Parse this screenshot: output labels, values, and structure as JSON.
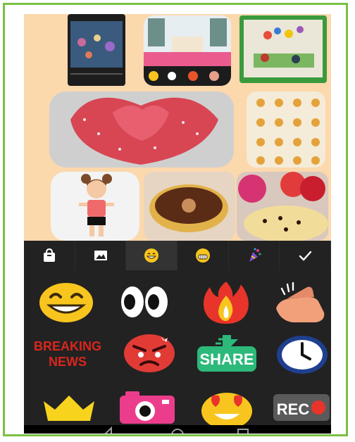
{
  "panel": {
    "tabs": [
      {
        "icon": "bag-icon"
      },
      {
        "icon": "image-icon"
      },
      {
        "icon": "grin-emoji-icon",
        "active": true
      },
      {
        "icon": "teeth-emoji-icon"
      },
      {
        "icon": "party-popper-icon"
      },
      {
        "icon": "checkmark-icon"
      }
    ],
    "stickers": {
      "breaking_line1": "BREAKING",
      "breaking_line2": "NEWS",
      "share": "SHARE",
      "rec": "REC"
    },
    "preview_toolbar_icons": [
      "bag-icon",
      "image-icon",
      "grin-emoji-icon",
      "teeth-emoji-icon",
      "party-popper-icon",
      "checkmark-icon"
    ]
  },
  "colors": {
    "frame_border": "#7ac043",
    "collage_background": "#fcd8ad",
    "panel_background": "#222222",
    "emoji_yellow": "#f7c51e",
    "angry_red": "#e23b36",
    "share_green": "#2cb97a",
    "camera_pink": "#ec3d8c"
  }
}
